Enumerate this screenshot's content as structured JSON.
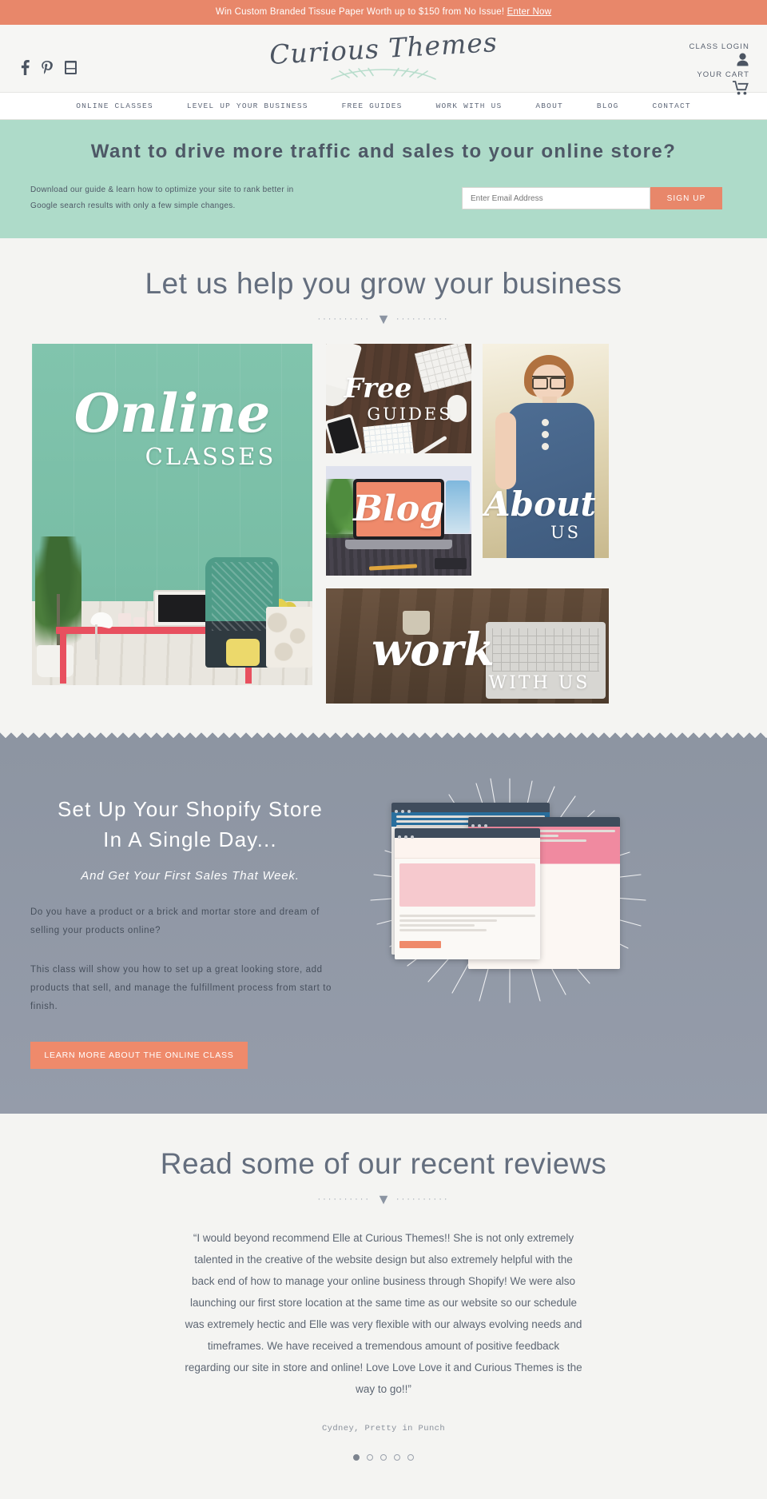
{
  "announcement": {
    "text": "Win Custom Branded Tissue Paper Worth up to $150 from No Issue!",
    "link_label": "Enter Now"
  },
  "header": {
    "logo_text": "Curious Themes",
    "social": [
      {
        "name": "facebook-icon",
        "label": "Facebook"
      },
      {
        "name": "pinterest-icon",
        "label": "Pinterest"
      },
      {
        "name": "youtube-icon",
        "label": "YouTube"
      }
    ],
    "class_login_label": "CLASS LOGIN",
    "your_cart_label": "YOUR CART"
  },
  "nav": {
    "items": [
      {
        "label": "ONLINE CLASSES"
      },
      {
        "label": "LEVEL UP YOUR BUSINESS"
      },
      {
        "label": "FREE GUIDES"
      },
      {
        "label": "WORK WITH US"
      },
      {
        "label": "ABOUT"
      },
      {
        "label": "BLOG"
      },
      {
        "label": "CONTACT"
      }
    ]
  },
  "optin": {
    "title": "Want to drive more traffic and sales to your online store?",
    "copy": "Download our guide & learn how to optimize your site to rank better in Google search results with only a few simple changes.",
    "placeholder": "Enter Email Address",
    "button_label": "SIGN UP",
    "bg_color": "#aedbc9",
    "accent_color": "#e8876a"
  },
  "grow": {
    "title": "Let us help you grow your business",
    "divider_dots_left": "··········",
    "divider_dots_right": "··········",
    "tiles": [
      {
        "script": "Online",
        "caps": "CLASSES"
      },
      {
        "script": "Free",
        "caps": "GUIDES"
      },
      {
        "script": "About",
        "caps": "US"
      },
      {
        "script": "Blog",
        "caps": ""
      },
      {
        "script": "work",
        "caps": "WITH US"
      }
    ]
  },
  "promo": {
    "heading_line1": "Set Up Your Shopify Store",
    "heading_line2": "In A Single Day...",
    "subheading": "And Get Your First Sales That Week.",
    "paragraph1": "Do you have a product or a brick and mortar store and dream of selling your products online?",
    "paragraph2": "This class will show you how to set up a great looking store, add products that sell, and manage the fulfillment process from start to finish.",
    "button_label": "LEARN MORE ABOUT THE ONLINE CLASS",
    "bg_color": "#8d95a2",
    "accent_color": "#ef8a6b"
  },
  "reviews": {
    "title": "Read some of our recent reviews",
    "divider_dots_left": "··········",
    "divider_dots_right": "··········",
    "quote": "“I would beyond recommend Elle at Curious Themes!! She is not only extremely talented in the creative of the website design but also extremely helpful with the back end of how to manage your online business through Shopify! We were also launching our first store location at the same time as our website so our schedule was extremely hectic and Elle was very flexible with our always evolving needs and timeframes. We have received a tremendous amount of positive feedback regarding our site in store and online! Love Love Love it and Curious Themes is the way to go!!”",
    "author": "Cydney, Pretty in Punch",
    "dot_count": 5,
    "active_dot": 0
  }
}
